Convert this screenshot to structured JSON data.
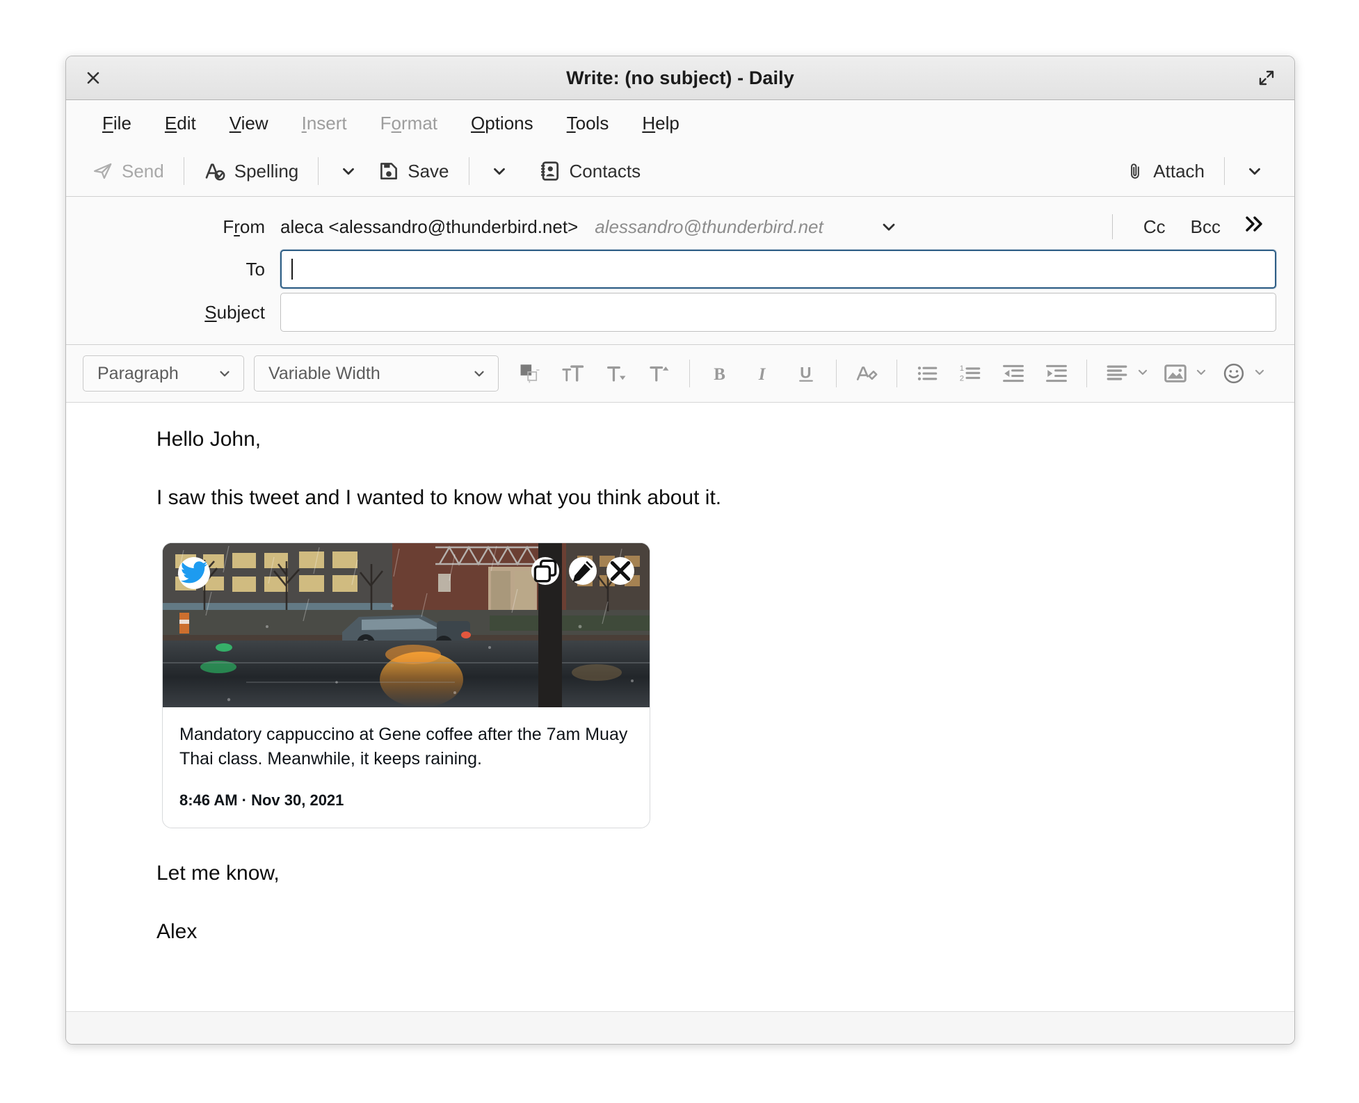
{
  "window": {
    "title": "Write: (no subject) - Daily",
    "close_label": "✕",
    "maximize_icon": "maximize-icon"
  },
  "menubar": {
    "items": [
      {
        "label": "File",
        "accel": "F",
        "disabled": false
      },
      {
        "label": "Edit",
        "accel": "E",
        "disabled": false
      },
      {
        "label": "View",
        "accel": "V",
        "disabled": false
      },
      {
        "label": "Insert",
        "accel": "I",
        "disabled": true
      },
      {
        "label": "Format",
        "accel": "o",
        "disabled": true
      },
      {
        "label": "Options",
        "accel": "O",
        "disabled": false
      },
      {
        "label": "Tools",
        "accel": "T",
        "disabled": false
      },
      {
        "label": "Help",
        "accel": "H",
        "disabled": false
      }
    ]
  },
  "toolbar": {
    "send_label": "Send",
    "spelling_label": "Spelling",
    "save_label": "Save",
    "contacts_label": "Contacts",
    "attach_label": "Attach"
  },
  "headers": {
    "from_label": "From",
    "from_value": "aleca <alessandro@thunderbird.net>",
    "from_hint": "alessandro@thunderbird.net",
    "cc_label": "Cc",
    "bcc_label": "Bcc",
    "expand_label": "»",
    "to_label": "To",
    "to_value": "",
    "to_placeholder": "",
    "subject_label": "Subject",
    "subject_value": "",
    "subject_placeholder": ""
  },
  "format_toolbar": {
    "paragraph_style": "Paragraph",
    "font_family": "Variable Width",
    "icons": [
      "text-color-swatch",
      "increase-font-size-icon",
      "decrease-font-size-icon",
      "font-size-menu-icon",
      "bold-icon",
      "italic-icon",
      "underline-icon",
      "remove-formatting-icon",
      "bulleted-list-icon",
      "numbered-list-icon",
      "outdent-icon",
      "indent-icon",
      "align-icon",
      "insert-image-icon",
      "insert-emoji-icon"
    ]
  },
  "message_body": {
    "greeting": "Hello John,",
    "intro": "I saw this tweet and I wanted to know what you think about it.",
    "closing": "Let me know,",
    "signature": "Alex"
  },
  "tweet_card": {
    "text": "Mandatory cappuccino at Gene coffee after the 7am Muay Thai class. Meanwhile, it keeps raining.",
    "timestamp": "8:46 AM · Nov 30, 2021",
    "brand_icon": "twitter-bird-icon",
    "actions": [
      {
        "name": "copy-icon",
        "title": "Copy"
      },
      {
        "name": "edit-icon",
        "title": "Edit"
      },
      {
        "name": "close-icon",
        "title": "Remove"
      }
    ]
  },
  "colors": {
    "accent_focus": "#2f5f86",
    "twitter_blue": "#1d9bf0",
    "toolbar_bg": "#fafafa",
    "titlebar_bg": "#e6e6e6",
    "body_text": "#0d0d0d"
  }
}
